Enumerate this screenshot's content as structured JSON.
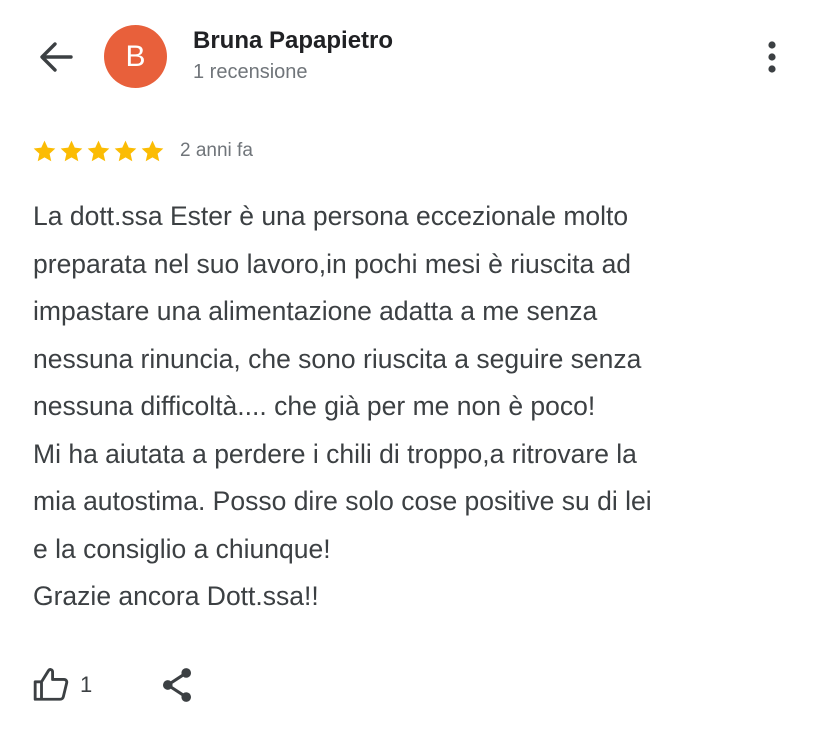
{
  "colors": {
    "avatar_bg": "#e8603b",
    "star": "#fbbc04",
    "icon": "#3c4043"
  },
  "header": {
    "back_icon": "arrow-left",
    "avatar_initial": "B",
    "user_name": "Bruna Papapietro",
    "user_meta": "1 recensione",
    "more_icon": "more-vertical"
  },
  "review": {
    "rating": 5,
    "rating_max": 5,
    "date": "2 anni fa",
    "text_lines": [
      "La dott.ssa Ester è una persona eccezionale molto",
      "preparata nel suo lavoro,in pochi mesi è riuscita ad",
      "impastare una alimentazione adatta a me senza",
      "nessuna rinuncia, che sono riuscita a seguire senza",
      "nessuna difficoltà.... che già per me non è poco!",
      "Mi ha aiutata a perdere i chili di troppo,a ritrovare la",
      "mia autostima. Posso dire solo cose positive su di lei",
      "e la consiglio a chiunque!",
      "Grazie ancora Dott.ssa!!"
    ]
  },
  "actions": {
    "like_icon": "thumbs-up",
    "like_count": "1",
    "share_icon": "share"
  }
}
